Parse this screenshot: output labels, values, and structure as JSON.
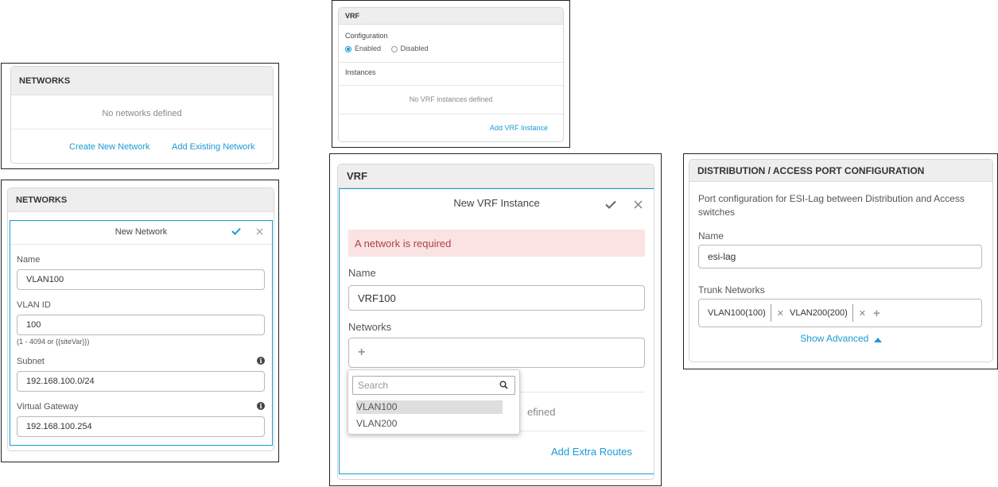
{
  "networks_empty": {
    "title": "NETWORKS",
    "empty_text": "No networks defined",
    "create_link": "Create New Network",
    "add_existing_link": "Add Existing Network"
  },
  "networks_form": {
    "title": "NETWORKS",
    "form_title": "New Network",
    "name_label": "Name",
    "name_value": "VLAN100",
    "vlan_label": "VLAN ID",
    "vlan_value": "100",
    "vlan_hint": "(1 - 4094 or {{siteVar}})",
    "subnet_label": "Subnet",
    "subnet_value": "192.168.100.0/24",
    "gateway_label": "Virtual Gateway",
    "gateway_value": "192.168.100.254"
  },
  "vrf_small": {
    "title": "VRF",
    "config_label": "Configuration",
    "enabled_label": "Enabled",
    "disabled_label": "Disabled",
    "selected": "Enabled",
    "instances_label": "Instances",
    "empty_text": "No VRF instances defined",
    "add_link": "Add VRF Instance"
  },
  "vrf_form": {
    "title": "VRF",
    "form_title": "New VRF Instance",
    "error_text": "A network is required",
    "name_label": "Name",
    "name_value": "VRF100",
    "networks_label": "Networks",
    "search_placeholder": "Search",
    "options": [
      "VLAN100",
      "VLAN200"
    ],
    "highlighted_option": "VLAN100",
    "hidden_text_fragment": "efined",
    "add_routes_link": "Add Extra Routes"
  },
  "distribution": {
    "title": "DISTRIBUTION / ACCESS PORT CONFIGURATION",
    "description": "Port configuration for ESI-Lag between Distribution and Access switches",
    "name_label": "Name",
    "name_value": "esi-lag",
    "trunk_label": "Trunk Networks",
    "chips": [
      "VLAN100(100)",
      "VLAN200(200)"
    ],
    "show_advanced": "Show Advanced"
  },
  "colors": {
    "accent": "#1a9ad6",
    "error_bg": "#fbe3e4",
    "error_text": "#a94442",
    "header_bg": "#eeeeee"
  }
}
